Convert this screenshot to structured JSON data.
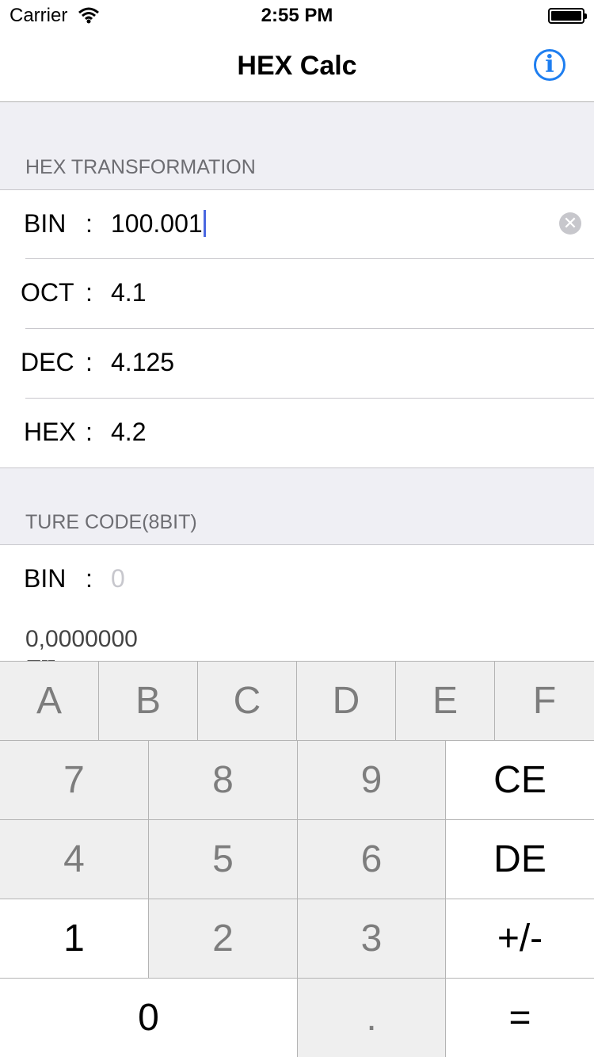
{
  "status_bar": {
    "carrier": "Carrier",
    "time": "2:55 PM"
  },
  "nav": {
    "title": "HEX Calc",
    "info_glyph": "i"
  },
  "hex_section": {
    "header": "HEX TRANSFORMATION",
    "rows": [
      {
        "label": "BIN",
        "colon": ":",
        "value": "100.001"
      },
      {
        "label": "OCT",
        "colon": ":",
        "value": "4.1"
      },
      {
        "label": "DEC",
        "colon": ":",
        "value": "4.125"
      },
      {
        "label": "HEX",
        "colon": ":",
        "value": "4.2"
      }
    ],
    "clear_glyph": "✕"
  },
  "true_code_section": {
    "header": "TURE CODE(8BIT)",
    "bin_label": "BIN",
    "bin_colon": ":",
    "bin_placeholder": "0",
    "result": "0,0000000",
    "result_sub": "原码(TURECODE)"
  },
  "keypad": {
    "hex_row": [
      "A",
      "B",
      "C",
      "D",
      "E",
      "F"
    ],
    "rows": [
      [
        "7",
        "8",
        "9",
        "CE"
      ],
      [
        "4",
        "5",
        "6",
        "DE"
      ],
      [
        "1",
        "2",
        "3",
        "+/-"
      ],
      [
        "0",
        ".",
        "="
      ]
    ]
  },
  "colors": {
    "accent": "#1e7ef0",
    "caret": "#4a67e0",
    "section_bg": "#efeff4"
  }
}
